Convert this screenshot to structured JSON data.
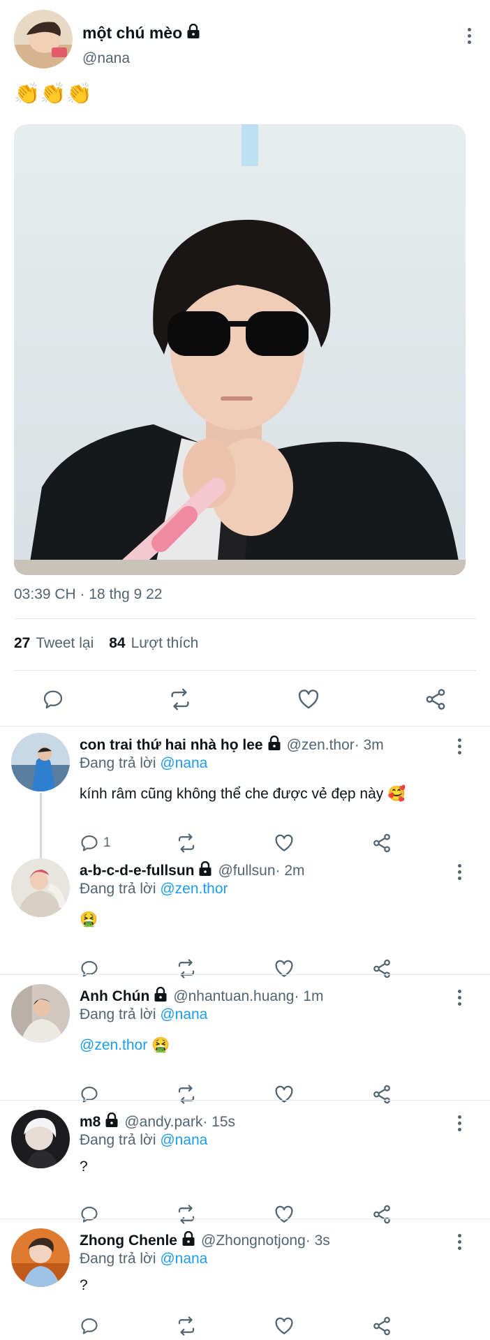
{
  "main_tweet": {
    "display_name": "một chú mèo",
    "handle": "@nana",
    "text": "👏👏👏",
    "timestamp": "03:39 CH · 18 thg 9 22",
    "retweets_count": "27",
    "retweets_label": "Tweet lại",
    "likes_count": "84",
    "likes_label": "Lượt thích"
  },
  "replies": [
    {
      "display_name": "con trai thứ hai nhà họ lee",
      "handle": "@zen.thor",
      "time": " · 3m",
      "replying_label": "Đang trả lời",
      "replying_to": "@nana",
      "text": "kính râm cũng không thể che được vẻ đẹp này 🥰",
      "mention": "",
      "reply_count": "1"
    },
    {
      "display_name": "a-b-c-d-e-fullsun",
      "handle": "@fullsun",
      "time": " · 2m",
      "replying_label": "Đang trả lời",
      "replying_to": "@zen.thor",
      "text": "🤮",
      "mention": "",
      "reply_count": ""
    },
    {
      "display_name": "Anh Chún",
      "handle": "@nhantuan.huang",
      "time": " · 1m",
      "replying_label": "Đang trả lời",
      "replying_to": "@nana",
      "mention": "@zen.thor",
      "text": " 🤮",
      "reply_count": ""
    },
    {
      "display_name": "m8",
      "handle": "@andy.park",
      "time": " · 15s",
      "replying_label": "Đang trả lời",
      "replying_to": "@nana",
      "text": "?",
      "mention": "",
      "reply_count": ""
    },
    {
      "display_name": "Zhong Chenle",
      "handle": "@Zhongnotjong",
      "time": " · 3s",
      "replying_label": "Đang trả lời",
      "replying_to": "@nana",
      "text": "?",
      "mention": "",
      "reply_count": ""
    }
  ],
  "colors": {
    "accent": "#1d9bf0",
    "muted": "#536471",
    "divider": "#e6e9ec"
  },
  "icons": [
    "lock-icon",
    "more-icon",
    "reply-icon",
    "retweet-icon",
    "like-icon",
    "share-icon"
  ]
}
